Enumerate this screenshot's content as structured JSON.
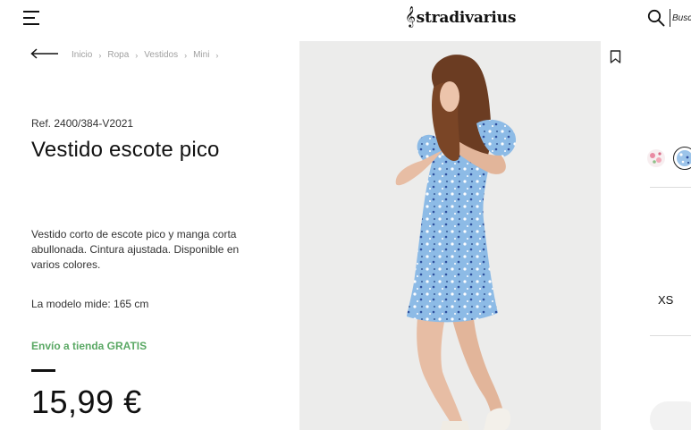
{
  "header": {
    "brand": "stradivarius",
    "brand_clef": "𝄞",
    "search_placeholder": "Buscar"
  },
  "breadcrumb": {
    "items": [
      "Inicio",
      "Ropa",
      "Vestidos",
      "Mini"
    ],
    "separator": "›"
  },
  "product": {
    "reference": "Ref. 2400/384-V2021",
    "title": "Vestido escote pico",
    "description": "Vestido corto de escote pico y manga corta abullonada. Cintura ajustada. Disponible en varios colores.",
    "model_height": "La modelo mide: 165 cm",
    "shipping": "Envío a tienda GRATIS",
    "price": "15,99 €"
  },
  "colors": [
    {
      "name": "floral-pink",
      "hex": "#f4dde3"
    },
    {
      "name": "floral-blue",
      "hex": "#9cc4ea",
      "selected": true
    }
  ],
  "sizes": [
    "XS"
  ],
  "theme": {
    "accent_green": "#5aa864",
    "text": "#1a1a1a",
    "muted": "#a0a0a0",
    "photo_bg": "#ececeb"
  },
  "icons": [
    "menu-icon",
    "stradivarius-logo",
    "search-icon",
    "back-arrow-icon",
    "bookmark-icon"
  ]
}
